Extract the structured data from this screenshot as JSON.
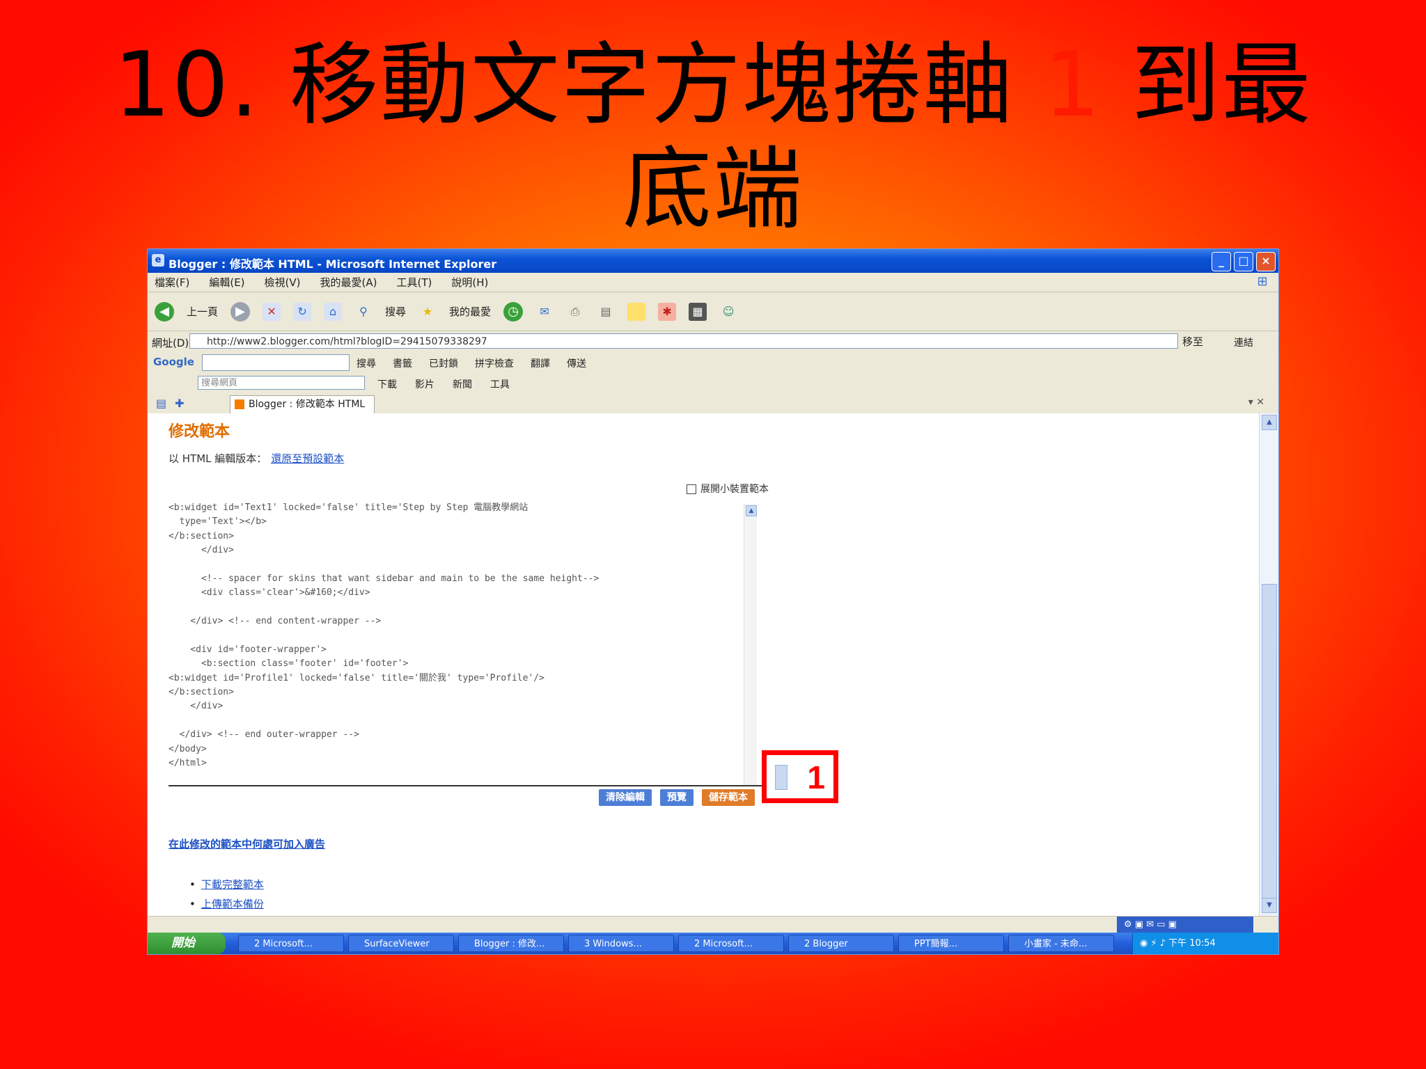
{
  "slide": {
    "title_prefix": "10. 移動文字方塊捲軸 ",
    "title_highlight": "1",
    "title_suffix": " 到最底端"
  },
  "browser": {
    "window_title": "Blogger : 修改範本 HTML - Microsoft Internet Explorer",
    "menu": [
      "檔案(F)",
      "編輯(E)",
      "檢視(V)",
      "我的最愛(A)",
      "工具(T)",
      "說明(H)"
    ],
    "toolbar": {
      "back_label": "上一頁",
      "search_label": "搜尋",
      "favorites_label": "我的最愛"
    },
    "address": {
      "label": "網址(D)",
      "url": "http://www2.blogger.com/html?blogID=29415079338297",
      "go_label": "移至",
      "links_label": "連結"
    },
    "google": {
      "logo": "Google",
      "items": [
        "搜尋",
        "書籤",
        "已封鎖",
        "拼字檢查",
        "翻譯",
        "傳送"
      ]
    },
    "linkbar": {
      "search_placeholder": "搜尋網頁",
      "items": [
        "下載",
        "影片",
        "新聞",
        "工具"
      ]
    },
    "tab": {
      "label": "Blogger : 修改範本 HTML"
    }
  },
  "page": {
    "heading": "修改範本",
    "subtitle": "以 HTML 編輯版本：",
    "subtitle_link": "還原至預設範本",
    "preview_label": "展開小裝置範本",
    "code_lines": [
      "<b:widget id='Text1' locked='false' title='Step by Step 電腦教學網站",
      "  type='Text'></b>",
      "</b:section>",
      "      </div>",
      "",
      "      <!-- spacer for skins that want sidebar and main to be the same height-->",
      "      <div class='clear'>&#160;</div>",
      "",
      "    </div> <!-- end content-wrapper -->",
      "",
      "    <div id='footer-wrapper'>",
      "      <b:section class='footer' id='footer'>",
      "<b:widget id='Profile1' locked='false' title='關於我' type='Profile'/>",
      "</b:section>",
      "    </div>",
      "",
      "  </div> <!-- end outer-wrapper -->",
      "</body>",
      "</html>"
    ],
    "buttons": {
      "clear": "清除編輯",
      "preview": "預覽",
      "save": "儲存範本"
    },
    "callout_number": "1",
    "bottom_link": "在此修改的範本中何處可加入廣告",
    "bullets": [
      "下載完整範本",
      "上傳範本備份"
    ]
  },
  "taskbar": {
    "start": "開始",
    "tasks": [
      "2 Microsoft...",
      "SurfaceViewer",
      "Blogger : 修改...",
      "3 Windows...",
      "2 Microsoft...",
      "2 Blogger",
      "PPT簡報...",
      "小畫家 - 未命..."
    ],
    "clock": "下午 10:54"
  },
  "colors": {
    "title_highlight": "#ff1a00",
    "callout": "#ff0000",
    "accent_orange": "#e06d00"
  }
}
